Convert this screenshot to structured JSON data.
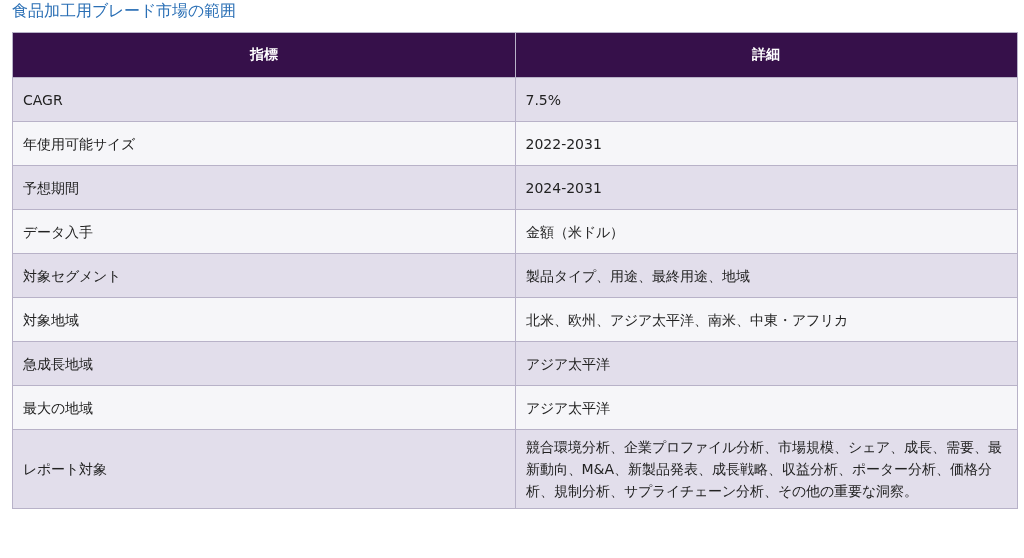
{
  "title": "食品加工用ブレード市場の範囲",
  "table": {
    "columns": [
      "指標",
      "詳細"
    ],
    "rows": [
      [
        "CAGR",
        "7.5%"
      ],
      [
        "年使用可能サイズ",
        "2022-2031"
      ],
      [
        "予想期間",
        "2024-2031"
      ],
      [
        "データ入手",
        "金額（米ドル）"
      ],
      [
        "対象セグメント",
        "製品タイプ、用途、最終用途、地域"
      ],
      [
        "対象地域",
        "北米、欧州、アジア太平洋、南米、中東・アフリカ"
      ],
      [
        "急成長地域",
        "アジア太平洋"
      ],
      [
        "最大の地域",
        "アジア太平洋"
      ],
      [
        "レポート対象",
        "競合環境分析、企業プロファイル分析、市場規模、シェア、成長、需要、最新動向、M&A、新製品発表、成長戦略、収益分析、ポーター分析、価格分析、規制分析、サプライチェーン分析、その他の重要な洞察。"
      ]
    ]
  }
}
